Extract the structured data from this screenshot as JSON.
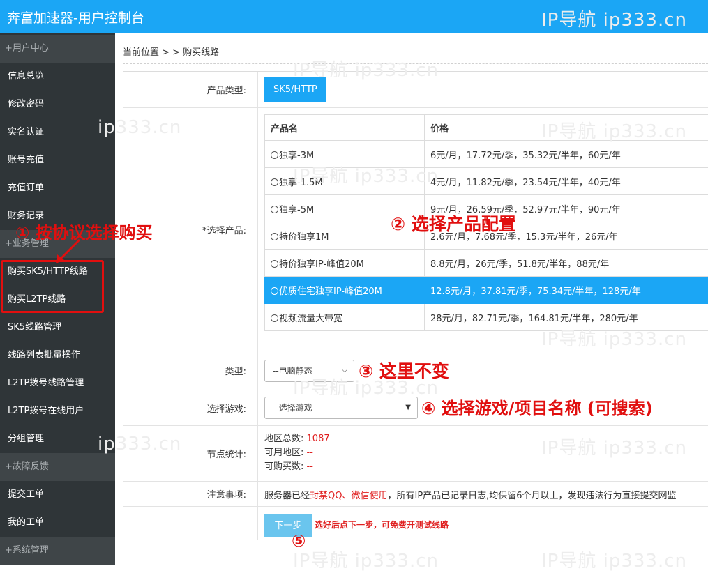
{
  "header": {
    "title": "奔富加速器-用户控制台"
  },
  "sidebar": {
    "items": [
      {
        "label": "+用户中心",
        "group": true
      },
      {
        "label": "信息总览"
      },
      {
        "label": "修改密码"
      },
      {
        "label": "实名认证"
      },
      {
        "label": "账号充值"
      },
      {
        "label": "充值订单"
      },
      {
        "label": "财务记录"
      },
      {
        "label": "+业务管理",
        "group": true
      },
      {
        "label": "购买SK5/HTTP线路"
      },
      {
        "label": "购买L2TP线路"
      },
      {
        "label": "SK5线路管理"
      },
      {
        "label": "线路列表批量操作"
      },
      {
        "label": "L2TP拨号线路管理"
      },
      {
        "label": "L2TP拨号在线用户"
      },
      {
        "label": "分组管理"
      },
      {
        "label": "+故障反馈",
        "group": true
      },
      {
        "label": "提交工单"
      },
      {
        "label": "我的工单"
      },
      {
        "label": "+系统管理",
        "group": true
      }
    ]
  },
  "breadcrumb": "当前位置 > > 购买线路",
  "form": {
    "product_type_label": "产品类型:",
    "product_type_value": "SK5/HTTP",
    "select_product_label": "*选择产品:",
    "table_headers": [
      "产品名",
      "价格"
    ],
    "products": [
      {
        "name": "独享-3M",
        "price": "6元/月，17.72元/季，35.32元/半年，60元/年",
        "selected": false
      },
      {
        "name": "独享-1.5M",
        "price": "4元/月，11.82元/季，23.54元/半年，40元/年",
        "selected": false
      },
      {
        "name": "独享-5M",
        "price": "9元/月，26.59元/季，52.97元/半年，90元/年",
        "selected": false
      },
      {
        "name": "特价独享1M",
        "price": "2.6元/月，7.68元/季，15.3元/半年，26元/年",
        "selected": false
      },
      {
        "name": "特价独享IP-峰值20M",
        "price": "8.8元/月，26元/季，51.8元/半年，88元/年",
        "selected": false
      },
      {
        "name": "优质住宅独享IP-峰值20M",
        "price": "12.8元/月，37.81元/季，75.34元/半年，128元/年",
        "selected": true
      },
      {
        "name": "视频流量大带宽",
        "price": "28元/月，82.71元/季，164.81元/半年，280元/年",
        "selected": false
      }
    ],
    "type_label": "类型:",
    "type_value": "--电脑静态",
    "game_label": "选择游戏:",
    "game_placeholder": "--选择游戏",
    "node_label": "节点统计:",
    "node_total_label": "地区总数:",
    "node_total_value": "1087",
    "node_avail_label": "可用地区:",
    "node_avail_value": "--",
    "node_buy_label": "可购买数:",
    "node_buy_value": "--",
    "notice_label": "注意事项:",
    "notice_pre": "服务器已经",
    "notice_red": "封禁QQ、微信使用",
    "notice_post": "，所有IP产品已记录日志,均保留6个月以上，发现违法行为直接提交网监",
    "next_button": "下一步",
    "next_hint": "选好后点下一步，可免费开测试线路"
  },
  "annotations": {
    "a1": "① 按协议选择购买",
    "a2": "② 选择产品配置",
    "a3": "③ 这里不变",
    "a4": "④ 选择游戏/项目名称 (可搜索)",
    "a5": "⑤"
  },
  "watermark": {
    "text": "IP导航  ip333.cn",
    "text_short": "ip333.cn"
  },
  "colors": {
    "accent": "#1ba6f5",
    "sidebar": "#2f3538",
    "annotation": "#e10f0f",
    "next_button": "#6ac5ee"
  }
}
